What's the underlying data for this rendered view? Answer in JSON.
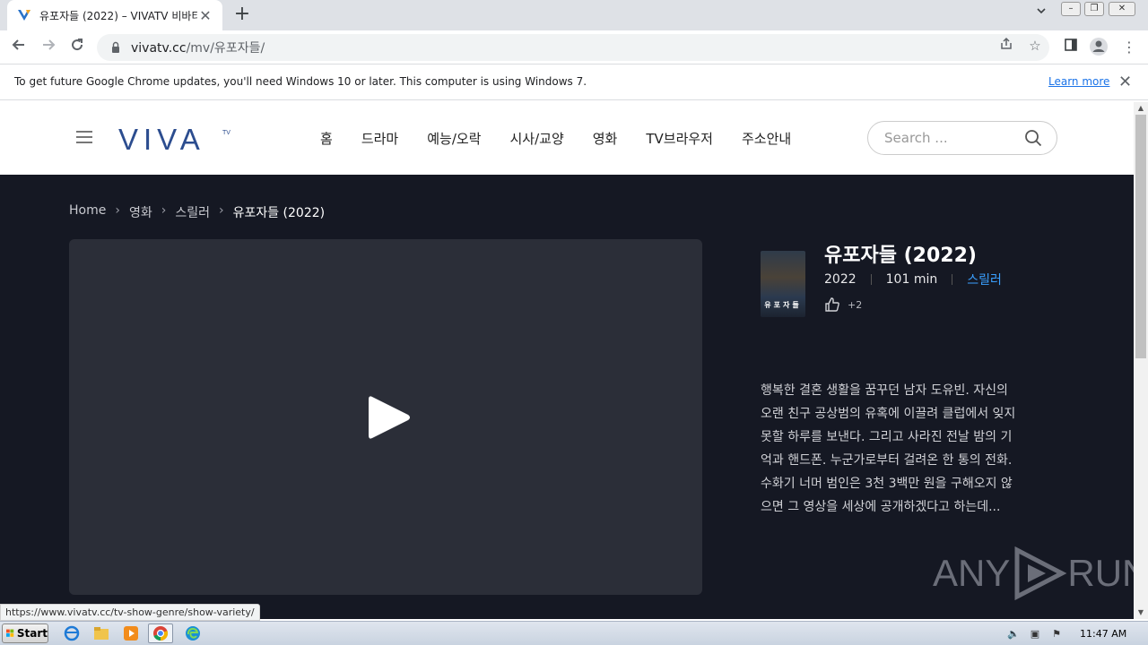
{
  "browser": {
    "tab_title": "유포자들 (2022) – VIVATV 비바티비",
    "tab_close": "✕",
    "new_tab": "+",
    "url_host": "vivatv.cc",
    "url_path": "/mv/유포자들/",
    "infobar_text": "To get future Google Chrome updates, you'll need Windows 10 or later. This computer is using Windows 7.",
    "infobar_link": "Learn more",
    "status_url": "https://www.vivatv.cc/tv-show-genre/show-variety/"
  },
  "site": {
    "logo_text": "VIVA",
    "logo_sup": "TV",
    "nav": [
      "홈",
      "드라마",
      "예능/오락",
      "시사/교양",
      "영화",
      "TV브라우저",
      "주소안내"
    ],
    "search_placeholder": "Search ..."
  },
  "breadcrumb": [
    "Home",
    "영화",
    "스릴러",
    "유포자들 (2022)"
  ],
  "movie": {
    "title": "유포자들 (2022)",
    "year": "2022",
    "runtime": "101 min",
    "genre": "스릴러",
    "likes": "+2",
    "poster_text": "유포자들",
    "synopsis": "행복한 결혼 생활을 꿈꾸던 남자 도유빈. 자신의 오랜 친구 공상범의 유혹에 이끌려 클럽에서 잊지 못할 하루를 보낸다. 그리고 사라진 전날 밤의 기억과 핸드폰. 누군가로부터 걸려온 한 통의 전화. 수화기 너머 범인은 3천 3백만 원을 구해오지 않으면 그 영상을 세상에 공개하겠다고 하는데..."
  },
  "watermark": {
    "left": "ANY",
    "right": "RUN"
  },
  "taskbar": {
    "start": "Start",
    "clock": "11:47 AM"
  },
  "colors": {
    "main_bg": "#151823",
    "player_bg": "#2b2e38",
    "accent": "#3aa0ff",
    "logo": "#2c4d8f"
  }
}
